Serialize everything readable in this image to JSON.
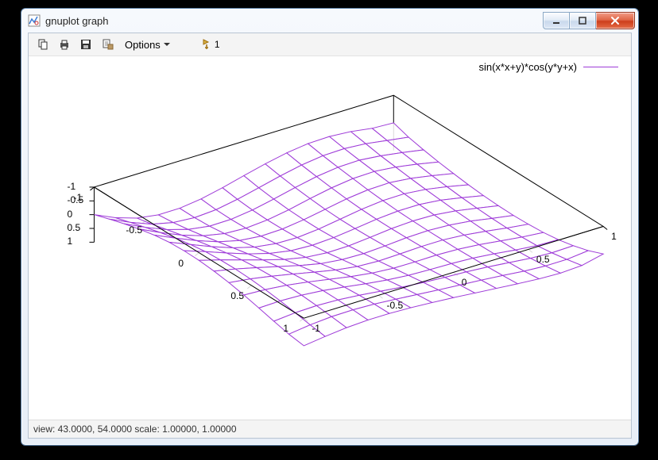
{
  "window": {
    "title": "gnuplot graph"
  },
  "toolbar": {
    "options_label": "Options",
    "replot_count": "1"
  },
  "legend": {
    "series1": "sin(x*x+y)*cos(y*y+x)"
  },
  "status": {
    "text": "view: 43.0000, 54.0000  scale: 1.00000, 1.00000"
  },
  "axes": {
    "x_ticks": [
      "-1",
      "-0.5",
      "0",
      "0.5",
      "1"
    ],
    "y_ticks": [
      "-1",
      "-0.5",
      "0",
      "0.5",
      "1"
    ],
    "z_ticks": [
      "-1",
      "-0.5",
      "0",
      "0.5",
      "1"
    ]
  },
  "colors": {
    "surface": "#9e3bd8",
    "axis": "#000000",
    "background": "#ffffff"
  },
  "chart_data": {
    "type": "surface3d",
    "function": "sin(x*x+y)*cos(y*y+x)",
    "x_range": [
      -1,
      1
    ],
    "y_range": [
      -1,
      1
    ],
    "z_range": [
      -1,
      1
    ],
    "grid_resolution": 15,
    "view": {
      "rot_x": 43.0,
      "rot_z": 54.0,
      "scale": [
        1.0,
        1.0
      ]
    },
    "x_ticks": [
      -1,
      -0.5,
      0,
      0.5,
      1
    ],
    "y_ticks": [
      -1,
      -0.5,
      0,
      0.5,
      1
    ],
    "z_ticks": [
      -1,
      -0.5,
      0,
      0.5,
      1
    ],
    "series": [
      {
        "name": "sin(x*x+y)*cos(y*y+x)",
        "color": "#9e3bd8",
        "z_samples": [
          [
            0.0,
            0.35,
            0.6,
            0.72,
            0.72,
            0.62,
            0.45,
            0.25,
            0.06,
            -0.1,
            -0.2,
            -0.22,
            -0.16,
            -0.04,
            0.0
          ],
          [
            -0.18,
            0.18,
            0.48,
            0.66,
            0.72,
            0.67,
            0.53,
            0.35,
            0.16,
            0.0,
            -0.1,
            -0.12,
            -0.06,
            0.06,
            0.18
          ],
          [
            -0.35,
            0.02,
            0.34,
            0.57,
            0.69,
            0.68,
            0.58,
            0.42,
            0.24,
            0.08,
            -0.02,
            -0.04,
            0.04,
            0.16,
            0.3
          ],
          [
            -0.5,
            -0.13,
            0.2,
            0.46,
            0.62,
            0.66,
            0.6,
            0.47,
            0.3,
            0.15,
            0.05,
            0.03,
            0.11,
            0.24,
            0.4
          ],
          [
            -0.62,
            -0.27,
            0.06,
            0.34,
            0.53,
            0.61,
            0.59,
            0.49,
            0.35,
            0.21,
            0.12,
            0.1,
            0.18,
            0.32,
            0.48
          ],
          [
            -0.7,
            -0.38,
            -0.06,
            0.22,
            0.43,
            0.54,
            0.56,
            0.49,
            0.37,
            0.25,
            0.17,
            0.16,
            0.24,
            0.38,
            0.55
          ],
          [
            -0.73,
            -0.46,
            -0.17,
            0.1,
            0.32,
            0.46,
            0.5,
            0.46,
            0.37,
            0.27,
            0.21,
            0.21,
            0.29,
            0.44,
            0.6
          ],
          [
            -0.72,
            -0.5,
            -0.26,
            -0.02,
            0.2,
            0.36,
            0.43,
            0.42,
            0.35,
            0.27,
            0.23,
            0.25,
            0.34,
            0.48,
            0.63
          ],
          [
            -0.67,
            -0.51,
            -0.32,
            -0.12,
            0.08,
            0.25,
            0.34,
            0.36,
            0.32,
            0.26,
            0.24,
            0.28,
            0.37,
            0.51,
            0.64
          ],
          [
            -0.59,
            -0.49,
            -0.35,
            -0.19,
            -0.02,
            0.14,
            0.25,
            0.29,
            0.27,
            0.24,
            0.24,
            0.3,
            0.4,
            0.52,
            0.62
          ],
          [
            -0.48,
            -0.44,
            -0.36,
            -0.24,
            -0.1,
            0.04,
            0.15,
            0.21,
            0.22,
            0.21,
            0.24,
            0.31,
            0.41,
            0.51,
            0.58
          ],
          [
            -0.35,
            -0.37,
            -0.34,
            -0.27,
            -0.16,
            -0.04,
            0.06,
            0.13,
            0.16,
            0.18,
            0.22,
            0.3,
            0.4,
            0.48,
            0.5
          ],
          [
            -0.21,
            -0.28,
            -0.3,
            -0.27,
            -0.2,
            -0.11,
            -0.02,
            0.05,
            0.1,
            0.14,
            0.2,
            0.28,
            0.36,
            0.4,
            0.38
          ],
          [
            -0.08,
            -0.18,
            -0.24,
            -0.25,
            -0.22,
            -0.16,
            -0.09,
            -0.02,
            0.04,
            0.1,
            0.17,
            0.25,
            0.3,
            0.3,
            0.22
          ],
          [
            0.0,
            -0.1,
            -0.18,
            -0.22,
            -0.22,
            -0.19,
            -0.14,
            -0.08,
            -0.01,
            0.06,
            0.13,
            0.19,
            0.22,
            0.18,
            0.0
          ]
        ]
      }
    ],
    "annotations": [],
    "title": "",
    "xlabel": "",
    "ylabel": "",
    "zlabel": ""
  }
}
